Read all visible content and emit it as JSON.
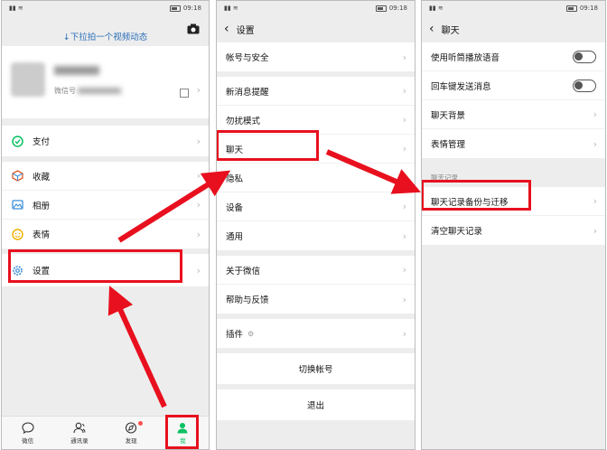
{
  "status": {
    "time": "09:18"
  },
  "me": {
    "pulldown_hint": "↓下拉拍一个视频动态",
    "wechat_id_label": "微信号",
    "menu": [
      {
        "label": "支付",
        "icon": "pay-icon"
      },
      {
        "label": "收藏",
        "icon": "favorites-icon"
      },
      {
        "label": "相册",
        "icon": "album-icon"
      },
      {
        "label": "表情",
        "icon": "sticker-icon"
      },
      {
        "label": "设置",
        "icon": "settings-gear-icon"
      }
    ],
    "tabs": [
      {
        "label": "微信",
        "icon": "chat-bubble-icon"
      },
      {
        "label": "通讯录",
        "icon": "contacts-icon"
      },
      {
        "label": "发现",
        "icon": "compass-icon"
      },
      {
        "label": "我",
        "icon": "person-icon"
      }
    ]
  },
  "settings": {
    "title": "设置",
    "items": [
      "帐号与安全",
      "新消息提醒",
      "勿扰模式",
      "聊天",
      "隐私",
      "设备",
      "通用",
      "关于微信",
      "帮助与反馈",
      "插件"
    ],
    "switch_account": "切换帐号",
    "logout": "退出"
  },
  "chat": {
    "title": "聊天",
    "toggles": [
      "使用听筒播放语音",
      "回车键发送消息"
    ],
    "items": [
      "聊天背景",
      "表情管理"
    ],
    "section_title": "聊天记录",
    "history_items": [
      "聊天记录备份与迁移",
      "清空聊天记录"
    ]
  },
  "colors": {
    "highlight": "#e8101e",
    "accent_green": "#07c160",
    "link_blue": "#2b6fb8"
  }
}
